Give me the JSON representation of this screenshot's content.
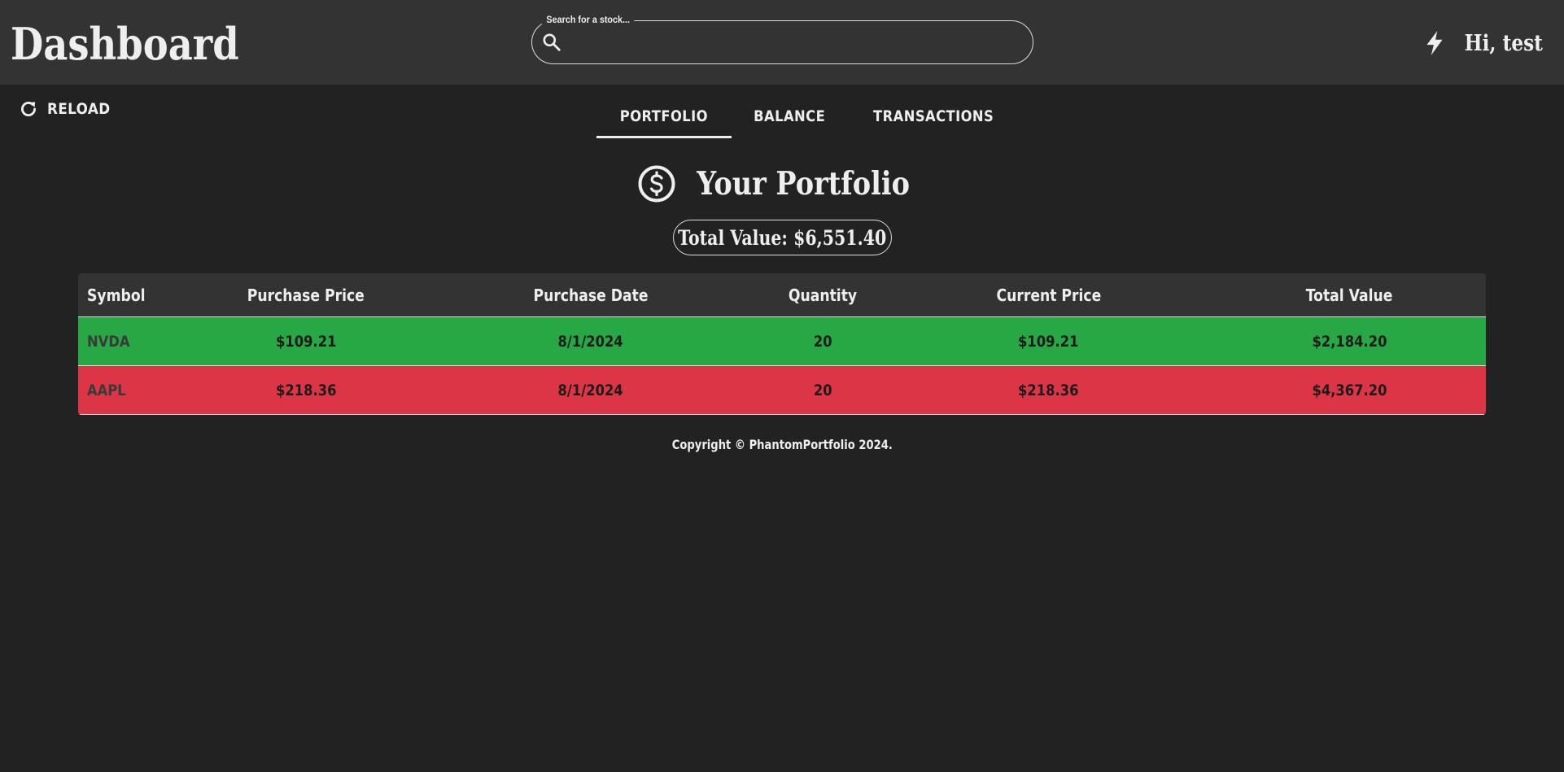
{
  "header": {
    "title": "Dashboard",
    "search": {
      "legend": "Search for a stock...",
      "value": "",
      "icon": "search-icon"
    },
    "user": {
      "greeting": "Hi, test",
      "icon": "bolt-icon"
    }
  },
  "toolbar": {
    "reload_label": "RELOAD",
    "reload_icon": "refresh-icon"
  },
  "tabs": [
    {
      "label": "PORTFOLIO",
      "active": true
    },
    {
      "label": "BALANCE",
      "active": false
    },
    {
      "label": "TRANSACTIONS",
      "active": false
    }
  ],
  "portfolio": {
    "title": "Your Portfolio",
    "title_icon": "dollar-circle-icon",
    "total_value_label": "Total Value: $6,551.40"
  },
  "table": {
    "columns": [
      "Symbol",
      "Purchase Price",
      "Purchase Date",
      "Quantity",
      "Current Price",
      "Total Value"
    ],
    "rows": [
      {
        "symbol": "NVDA",
        "purchase_price": "$109.21",
        "purchase_date": "8/1/2024",
        "quantity": "20",
        "current_price": "$109.21",
        "total_value": "$2,184.20",
        "row_color": "#28a745"
      },
      {
        "symbol": "AAPL",
        "purchase_price": "$218.36",
        "purchase_date": "8/1/2024",
        "quantity": "20",
        "current_price": "$218.36",
        "total_value": "$4,367.20",
        "row_color": "#dc3545"
      }
    ]
  },
  "footer": {
    "copyright": "Copyright © PhantomPortfolio 2024."
  },
  "colors": {
    "background": "#222222",
    "header_bg": "#333333",
    "text": "#eeeeee",
    "gain_row": "#28a745",
    "loss_row": "#dc3545"
  }
}
